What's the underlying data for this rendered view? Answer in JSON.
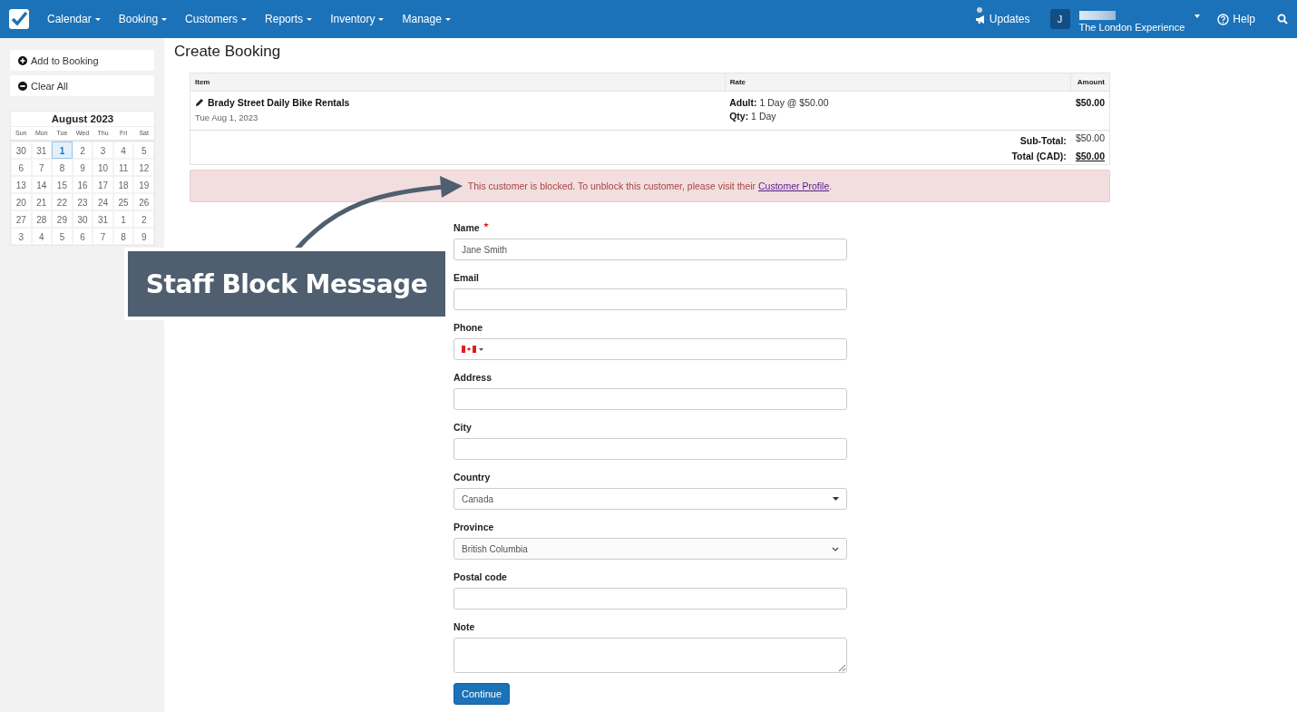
{
  "nav": {
    "menus": [
      {
        "label": "Calendar"
      },
      {
        "label": "Booking"
      },
      {
        "label": "Customers"
      },
      {
        "label": "Reports"
      },
      {
        "label": "Inventory"
      },
      {
        "label": "Manage"
      }
    ],
    "updates": "Updates",
    "avatar": "J",
    "account": "The London Experience",
    "help": "Help"
  },
  "sidebar": {
    "buttons": [
      {
        "label": "Add to Booking",
        "kind": "add"
      },
      {
        "label": "Clear All",
        "kind": "remove"
      }
    ],
    "calendar": {
      "month": "August 2023",
      "weekdays": [
        "Sun",
        "Mon",
        "Tue",
        "Wed",
        "Thu",
        "Fri",
        "Sat"
      ],
      "days": [
        {
          "label": "30",
          "selected": false
        },
        {
          "label": "31",
          "selected": false
        },
        {
          "label": "1",
          "selected": true
        },
        {
          "label": "2",
          "selected": false
        },
        {
          "label": "3",
          "selected": false
        },
        {
          "label": "4",
          "selected": false
        },
        {
          "label": "5",
          "selected": false
        },
        {
          "label": "6",
          "selected": false
        },
        {
          "label": "7",
          "selected": false
        },
        {
          "label": "8",
          "selected": false
        },
        {
          "label": "9",
          "selected": false
        },
        {
          "label": "10",
          "selected": false
        },
        {
          "label": "11",
          "selected": false
        },
        {
          "label": "12",
          "selected": false
        },
        {
          "label": "13",
          "selected": false
        },
        {
          "label": "14",
          "selected": false
        },
        {
          "label": "15",
          "selected": false
        },
        {
          "label": "16",
          "selected": false
        },
        {
          "label": "17",
          "selected": false
        },
        {
          "label": "18",
          "selected": false
        },
        {
          "label": "19",
          "selected": false
        },
        {
          "label": "20",
          "selected": false
        },
        {
          "label": "21",
          "selected": false
        },
        {
          "label": "22",
          "selected": false
        },
        {
          "label": "23",
          "selected": false
        },
        {
          "label": "24",
          "selected": false
        },
        {
          "label": "25",
          "selected": false
        },
        {
          "label": "26",
          "selected": false
        },
        {
          "label": "27",
          "selected": false
        },
        {
          "label": "28",
          "selected": false
        },
        {
          "label": "29",
          "selected": false
        },
        {
          "label": "30",
          "selected": false
        },
        {
          "label": "31",
          "selected": false
        },
        {
          "label": "1",
          "selected": false
        },
        {
          "label": "2",
          "selected": false
        },
        {
          "label": "3",
          "selected": false
        },
        {
          "label": "4",
          "selected": false
        },
        {
          "label": "5",
          "selected": false
        },
        {
          "label": "6",
          "selected": false
        },
        {
          "label": "7",
          "selected": false
        },
        {
          "label": "8",
          "selected": false
        },
        {
          "label": "9",
          "selected": false
        }
      ]
    }
  },
  "page_title": "Create Booking",
  "cart": {
    "columns": [
      "Item",
      "Rate",
      "Amount"
    ],
    "rows": [
      {
        "item": "Brady Street Daily Bike Rentals",
        "date": "Tue Aug 1, 2023",
        "rate": [
          {
            "label": "Adult:",
            "value": "1 Day @ $50.00"
          },
          {
            "label": "Qty:",
            "value": "1 Day"
          }
        ],
        "amount": "$50.00"
      }
    ],
    "totals": [
      {
        "label": "Sub-Total:",
        "value": "$50.00",
        "underline": false
      },
      {
        "label": "Total (CAD):",
        "value": "$50.00",
        "underline": true
      }
    ]
  },
  "alert": {
    "text": "This customer is blocked. To unblock this customer, please visit their",
    "link": "Customer Profile",
    "end": "."
  },
  "form": {
    "fields": [
      {
        "label": "Name",
        "required": true,
        "kind": "text",
        "value": "Jane Smith"
      },
      {
        "label": "Email",
        "required": false,
        "kind": "text"
      },
      {
        "label": "Phone",
        "required": false,
        "kind": "phone"
      },
      {
        "label": "Address",
        "required": false,
        "kind": "text"
      },
      {
        "label": "City",
        "required": false,
        "kind": "text"
      },
      {
        "label": "Country",
        "required": false,
        "kind": "select",
        "value": "Canada"
      },
      {
        "label": "Province",
        "required": false,
        "kind": "native-select",
        "value": "British Columbia"
      },
      {
        "label": "Postal code",
        "required": false,
        "kind": "text"
      },
      {
        "label": "Note",
        "required": false,
        "kind": "textarea"
      }
    ],
    "submit": "Continue"
  },
  "annotation": {
    "text": "Staff Block Message"
  }
}
